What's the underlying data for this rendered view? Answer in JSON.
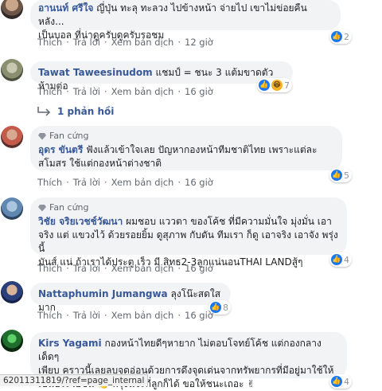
{
  "actions": {
    "like": "Thích",
    "reply": "Trả lời",
    "translate": "Xem bản dịch"
  },
  "badge_label": "Fan cứng",
  "comments": [
    {
      "name": "อานนท์ ศรีใจ",
      "text_line1": "ญี่ปุ่น ทะลุ ทะลวง ไปข้างหน้า จ่ายไป เขาไม่ข่อยคืนหลัง...",
      "text_line2": "เป็นบอล ที่น่าดูครับดูครับรอชม",
      "time": "12 giờ",
      "reaction_count": "2"
    },
    {
      "name": "Tawat Taweesinudom",
      "text_line1": "แชมป์ = ชนะ 3 แต้มขาดตัวห้ามต่อ",
      "time": "16 giờ",
      "reaction_count": "7"
    },
    {
      "name": "อุดร ขันตรี",
      "text_line1": "ฟังแล้วเข้าใจเลย ปัญหากองหน้าทีมชาติไทย เพราะแต่ละ",
      "text_line2": "สโมสร ใช้แต่กองหน้าต่างชาติ",
      "time": "16 giờ",
      "reaction_count": "5"
    },
    {
      "name": "วิชัย จริยเวชช์วัฒนา",
      "text_line1": "ผมชอบ แววตา ของโค้ช ที่มีความมั่นใจ มุ่งมั่น เอา",
      "text_line2": "จริง แต่ แขวงไว้ ด้วยรอยยิ้ม ดูสุภาพ กับดัน ทีมเรา ก็ดู เอาจริง เอาจัง พรุ่งนี้",
      "text_line3": "มันส์ แน่ ถ้าเราได้ประตู เร็ว มี สิทธ2-3ลูกแน่นอนTHAI LANDสู้ๆ",
      "time": "16 giờ",
      "reaction_count": "4"
    },
    {
      "name": "Nattaphumin Jumangwa",
      "text_line1": "ลุงโน๊ะสดใสมาก",
      "time": "16 giờ",
      "reaction_count": "8"
    },
    {
      "name": "Kirs Yagami",
      "text_line1": "กองหน้าไทยดีๆหายาก ไม่ตอบโจทย์โค้ช แต่กองกลางเด็ดๆ",
      "text_line2": "เพียบ คราวนี้เลยลบจุดอ่อนด้วยการดึงจุดเด่นจากทรัพยากรที่มีอยู่มาใช้ให้",
      "text_line3": "เป็นประโยชน์ 👏 พรุ่งนี้จะกี่ลูกก็ได้ ขอให้ชนะเถอะ ✌",
      "reaction_count": "4"
    }
  ],
  "replies_label": "1 phản hồi",
  "status_url": "62011311819/?ref=page_internal"
}
